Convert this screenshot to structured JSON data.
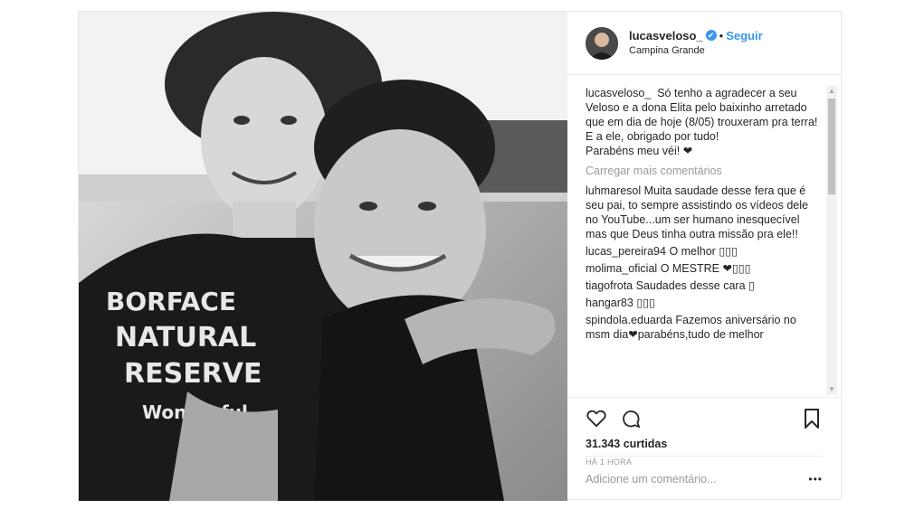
{
  "header": {
    "username": "lucasveloso_",
    "verified_badge": "✔",
    "dot": "•",
    "follow_label": "Seguir",
    "location": "Campina Grande"
  },
  "caption": {
    "username": "lucasveloso_",
    "text": "Só tenho a agradecer a seu Veloso e a dona Elita pelo baixinho arretado que em dia de hoje (8/05) trouxeram pra terra! E a ele, obrigado por tudo!",
    "text2": "Parabéns meu véi! ❤"
  },
  "load_more": "Carregar mais comentários",
  "comments": [
    {
      "user": "luhmaresol",
      "text": "Muita saudade desse fera que é seu pai, to sempre assistindo os vídeos dele no YouTube...um ser humano inesquecível mas que Deus tinha outra missão pra ele!!"
    },
    {
      "user": "lucas_pereira94",
      "text": "O melhor ▯▯▯"
    },
    {
      "user": "molima_oficial",
      "text": "O MESTRE ❤▯▯▯"
    },
    {
      "user": "tiagofrota",
      "text": "Saudades desse cara ▯"
    },
    {
      "user": "hangar83",
      "text": "▯▯▯"
    },
    {
      "user": "spindola.eduarda",
      "text": "Fazemos aniversário no msm dia❤parabéns,tudo de melhor"
    }
  ],
  "likes": "31.343 curtidas",
  "time": "HÁ 1 HORA",
  "add_comment_placeholder": "Adicione um comentário...",
  "more_options": "•••",
  "icons": {
    "like": "heart-icon",
    "comment": "comment-icon",
    "save": "bookmark-icon"
  }
}
